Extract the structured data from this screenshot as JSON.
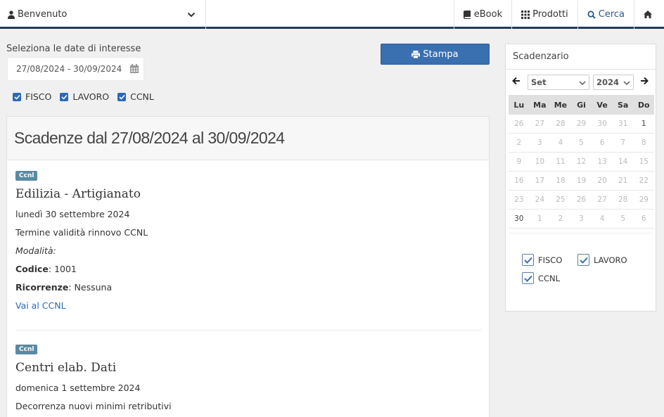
{
  "topbar": {
    "user_label": "Benvenuto",
    "nav": [
      {
        "label": "eBook",
        "icon": "book-icon"
      },
      {
        "label": "Prodotti",
        "icon": "grid-icon"
      },
      {
        "label": "Cerca",
        "icon": "search-icon"
      },
      {
        "label": "",
        "icon": "home-icon"
      }
    ]
  },
  "filters": {
    "date_label": "Seleziona le date di interesse",
    "date_value": "27/08/2024 - 30/09/2024",
    "print_label": "Stampa",
    "checks": [
      {
        "label": "FISCO",
        "checked": true
      },
      {
        "label": "LAVORO",
        "checked": true
      },
      {
        "label": "CCNL",
        "checked": true
      }
    ]
  },
  "results": {
    "heading": "Scadenze dal 27/08/2024 al 30/09/2024",
    "entries": [
      {
        "badge": "Ccnl",
        "title": "Edilizia - Artigianato",
        "date": "lunedì 30 settembre 2024",
        "description": "Termine validità rinnovo CCNL",
        "modalita_label": "Modalità:",
        "codice_label": "Codice",
        "codice_value": ": 1001",
        "ricorrenze_label": "Ricorrenze",
        "ricorrenze_value": ": Nessuna",
        "link": "Vai al CCNL"
      },
      {
        "badge": "Ccnl",
        "title": "Centri elab. Dati",
        "date": "domenica 1 settembre 2024",
        "description": "Decorrenza nuovi minimi retributivi"
      }
    ]
  },
  "scadenzario": {
    "title": "Scadenzario",
    "month": "Set",
    "year": "2024",
    "weekdays": [
      "Lu",
      "Ma",
      "Me",
      "Gi",
      "Ve",
      "Sa",
      "Do"
    ],
    "weeks": [
      [
        {
          "d": "26",
          "cur": false
        },
        {
          "d": "27",
          "cur": false
        },
        {
          "d": "28",
          "cur": false
        },
        {
          "d": "29",
          "cur": false
        },
        {
          "d": "30",
          "cur": false
        },
        {
          "d": "31",
          "cur": false
        },
        {
          "d": "1",
          "cur": true
        }
      ],
      [
        {
          "d": "2",
          "cur": false
        },
        {
          "d": "3",
          "cur": false
        },
        {
          "d": "4",
          "cur": false
        },
        {
          "d": "5",
          "cur": false
        },
        {
          "d": "6",
          "cur": false
        },
        {
          "d": "7",
          "cur": false
        },
        {
          "d": "8",
          "cur": false
        }
      ],
      [
        {
          "d": "9",
          "cur": false
        },
        {
          "d": "10",
          "cur": false
        },
        {
          "d": "11",
          "cur": false
        },
        {
          "d": "12",
          "cur": false
        },
        {
          "d": "13",
          "cur": false
        },
        {
          "d": "14",
          "cur": false
        },
        {
          "d": "15",
          "cur": false
        }
      ],
      [
        {
          "d": "16",
          "cur": false
        },
        {
          "d": "17",
          "cur": false
        },
        {
          "d": "18",
          "cur": false
        },
        {
          "d": "19",
          "cur": false
        },
        {
          "d": "20",
          "cur": false
        },
        {
          "d": "21",
          "cur": false
        },
        {
          "d": "22",
          "cur": false
        }
      ],
      [
        {
          "d": "23",
          "cur": false
        },
        {
          "d": "24",
          "cur": false
        },
        {
          "d": "25",
          "cur": false
        },
        {
          "d": "26",
          "cur": false
        },
        {
          "d": "27",
          "cur": false
        },
        {
          "d": "28",
          "cur": false
        },
        {
          "d": "29",
          "cur": false
        }
      ],
      [
        {
          "d": "30",
          "cur": true
        },
        {
          "d": "1",
          "cur": false
        },
        {
          "d": "2",
          "cur": false
        },
        {
          "d": "3",
          "cur": false
        },
        {
          "d": "4",
          "cur": false
        },
        {
          "d": "5",
          "cur": false
        },
        {
          "d": "6",
          "cur": false
        }
      ]
    ],
    "legend": [
      {
        "label": "FISCO",
        "checked": true
      },
      {
        "label": "LAVORO",
        "checked": true
      },
      {
        "label": "CCNL",
        "checked": true
      }
    ]
  },
  "colors": {
    "accent": "#3a6fb0",
    "topbar_border": "#1f3a5f",
    "badge": "#5a8aa5",
    "link": "#2a6ab8"
  }
}
